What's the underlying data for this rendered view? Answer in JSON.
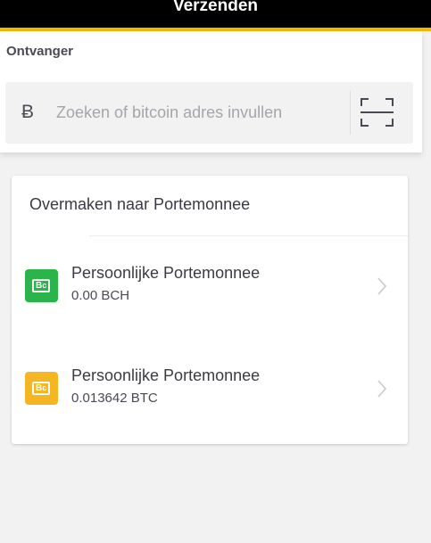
{
  "header": {
    "title": "Verzenden"
  },
  "recipient": {
    "label": "Ontvanger",
    "currency_glyph": "Ƀ",
    "search_placeholder": "Zoeken of bitcoin adres invullen",
    "search_value": ""
  },
  "transfer": {
    "title": "Overmaken naar Portemonnee",
    "wallets": [
      {
        "name": "Persoonlijke Portemonnee",
        "amount": "0.00 BCH",
        "icon": "wallet-icon",
        "color": "#2ab44a"
      },
      {
        "name": "Persoonlijke Portemonnee",
        "amount": "0.013642 BTC",
        "icon": "wallet-icon",
        "color": "#f5b623"
      }
    ]
  },
  "theme": {
    "accent": "#f6b400",
    "header_bg": "#000000"
  }
}
